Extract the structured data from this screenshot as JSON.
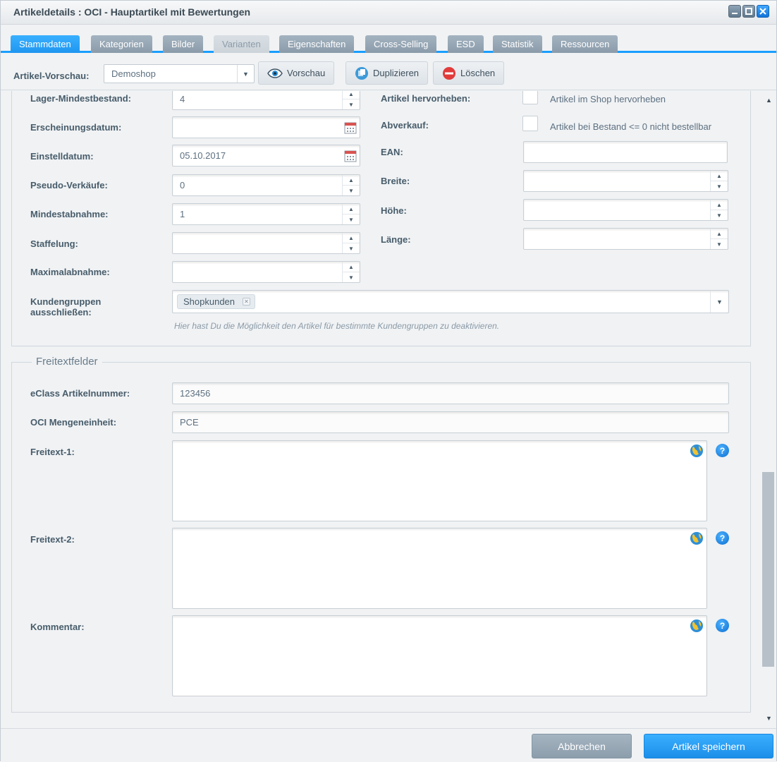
{
  "window": {
    "title": "Artikeldetails : OCI - Hauptartikel mit Bewertungen"
  },
  "tabs": [
    {
      "label": "Stammdaten",
      "state": "active"
    },
    {
      "label": "Kategorien",
      "state": "normal"
    },
    {
      "label": "Bilder",
      "state": "normal"
    },
    {
      "label": "Varianten",
      "state": "disabled"
    },
    {
      "label": "Eigenschaften",
      "state": "normal"
    },
    {
      "label": "Cross-Selling",
      "state": "normal"
    },
    {
      "label": "ESD",
      "state": "normal"
    },
    {
      "label": "Statistik",
      "state": "normal"
    },
    {
      "label": "Ressourcen",
      "state": "normal"
    }
  ],
  "toolbar": {
    "preview_label": "Artikel-Vorschau:",
    "shop_value": "Demoshop",
    "preview_button": "Vorschau",
    "duplicate_button": "Duplizieren",
    "delete_button": "Löschen"
  },
  "stock": {
    "min_stock_label": "Lager-Mindestbestand:",
    "min_stock_value": "4",
    "release_date_label": "Erscheinungsdatum:",
    "release_date_value": "",
    "added_date_label": "Einstelldatum:",
    "added_date_value": "05.10.2017",
    "pseudo_sales_label": "Pseudo-Verkäufe:",
    "pseudo_sales_value": "0",
    "min_purchase_label": "Mindestabnahme:",
    "min_purchase_value": "1",
    "graduation_label": "Staffelung:",
    "graduation_value": "",
    "max_purchase_label": "Maximalabnahme:",
    "max_purchase_value": "",
    "highlight_label": "Artikel hervorheben:",
    "highlight_text": "Artikel im Shop hervorheben",
    "sale_label": "Abverkauf:",
    "sale_text": "Artikel bei Bestand <= 0 nicht bestellbar",
    "ean_label": "EAN:",
    "ean_value": "",
    "width_label": "Breite:",
    "width_value": "",
    "height_label": "Höhe:",
    "height_value": "",
    "length_label": "Länge:",
    "length_value": "",
    "customer_groups_label_1": "Kundengruppen",
    "customer_groups_label_2": "ausschließen:",
    "customer_groups_tag": "Shopkunden",
    "customer_groups_hint": "Hier hast Du die Möglichkeit den Artikel für bestimmte Kundengruppen zu deaktivieren."
  },
  "freetext": {
    "legend": "Freitextfelder",
    "eclass_label": "eClass Artikelnummer:",
    "eclass_value": "123456",
    "oci_unit_label": "OCI Mengeneinheit:",
    "oci_unit_value": "PCE",
    "freetext1_label": "Freitext-1:",
    "freetext2_label": "Freitext-2:",
    "comment_label": "Kommentar:"
  },
  "footer": {
    "cancel_button": "Abbrechen",
    "save_button": "Artikel speichern"
  },
  "colors": {
    "accent": "#189eff",
    "delete": "#e23b3b"
  }
}
